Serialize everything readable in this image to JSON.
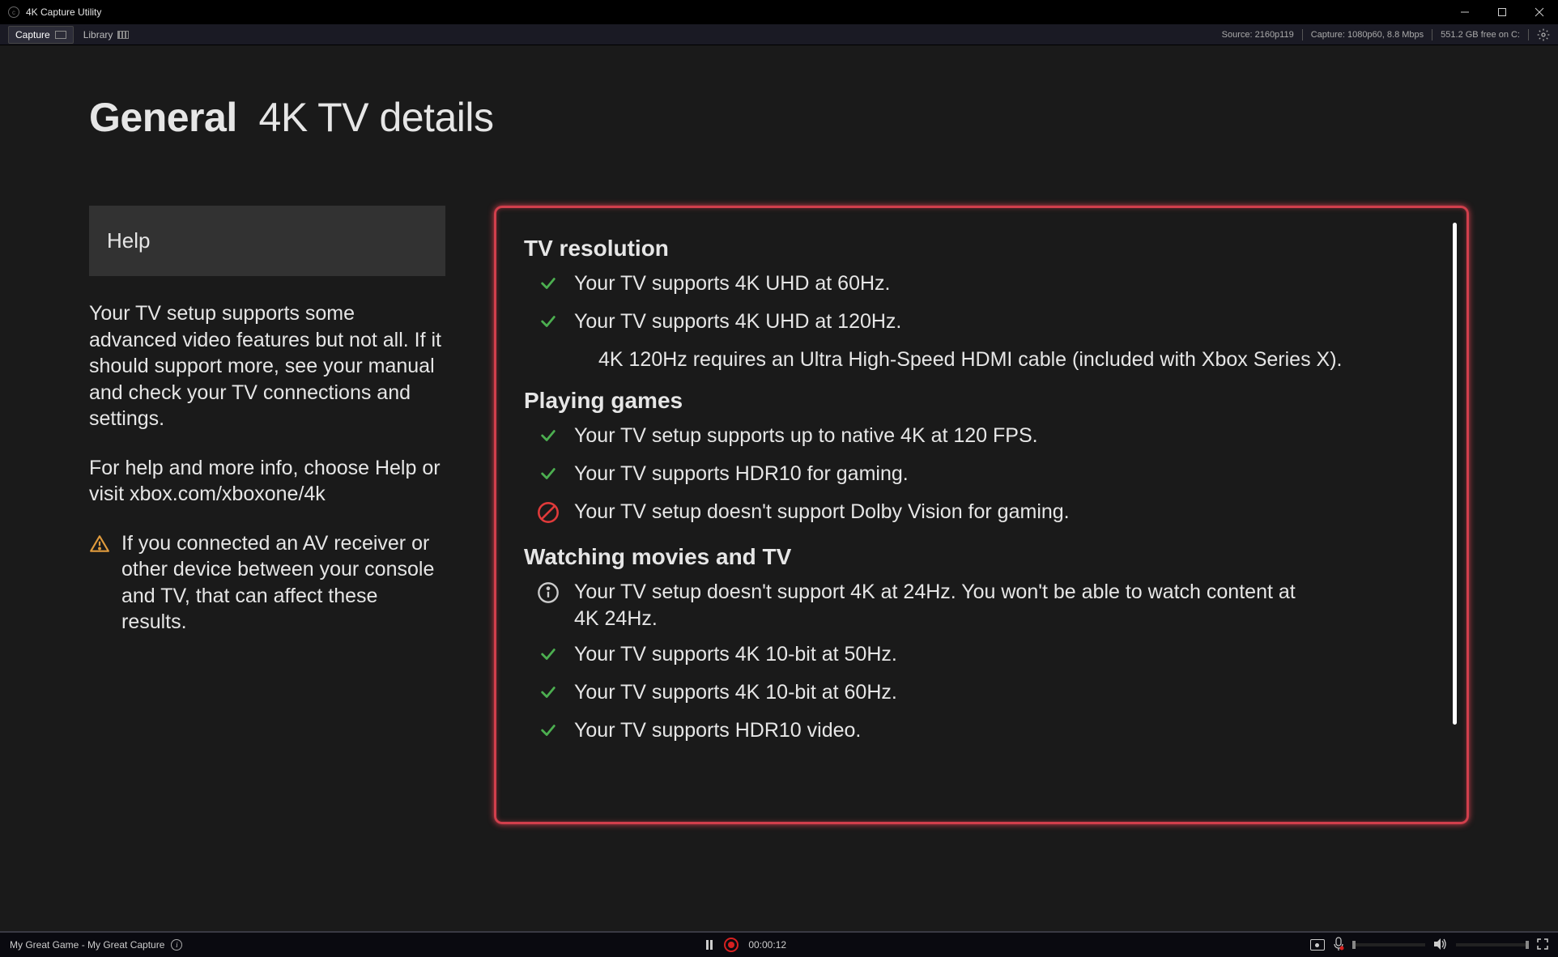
{
  "window": {
    "title": "4K Capture Utility"
  },
  "toolbar": {
    "tab_capture": "Capture",
    "tab_library": "Library",
    "source_info": "Source: 2160p119",
    "capture_info": "Capture: 1080p60, 8.8 Mbps",
    "disk_info": "551.2 GB free on C:"
  },
  "page": {
    "heading_bold": "General",
    "heading_rest": "4K TV details"
  },
  "left": {
    "help_label": "Help",
    "para1": "Your TV setup supports some advanced video features but not all. If it should support more, see your manual and check your TV connections and settings.",
    "para2": "For help and more info, choose Help or visit xbox.com/xboxone/4k",
    "warn_text": "If you connected an AV receiver or other device between your console and TV, that can affect these results."
  },
  "panel": {
    "sec1_title": "TV resolution",
    "sec1_item1": "Your TV supports 4K UHD at 60Hz.",
    "sec1_item2": "Your TV supports 4K UHD at 120Hz.",
    "sec1_note": "4K 120Hz requires an Ultra High-Speed HDMI cable (included with Xbox Series X).",
    "sec2_title": "Playing games",
    "sec2_item1": "Your TV setup supports up to native 4K at 120 FPS.",
    "sec2_item2": "Your TV supports HDR10 for gaming.",
    "sec2_item3": "Your TV setup doesn't support Dolby Vision for gaming.",
    "sec3_title": "Watching movies and TV",
    "sec3_item1": "Your TV setup doesn't support 4K at 24Hz. You won't be able to watch content at 4K 24Hz.",
    "sec3_item2": "Your TV supports 4K 10-bit at 50Hz.",
    "sec3_item3": "Your TV supports 4K 10-bit at 60Hz.",
    "sec3_item4": "Your TV supports HDR10 video."
  },
  "bottom": {
    "title": "My Great Game - My Great Capture",
    "timer": "00:00:12"
  }
}
